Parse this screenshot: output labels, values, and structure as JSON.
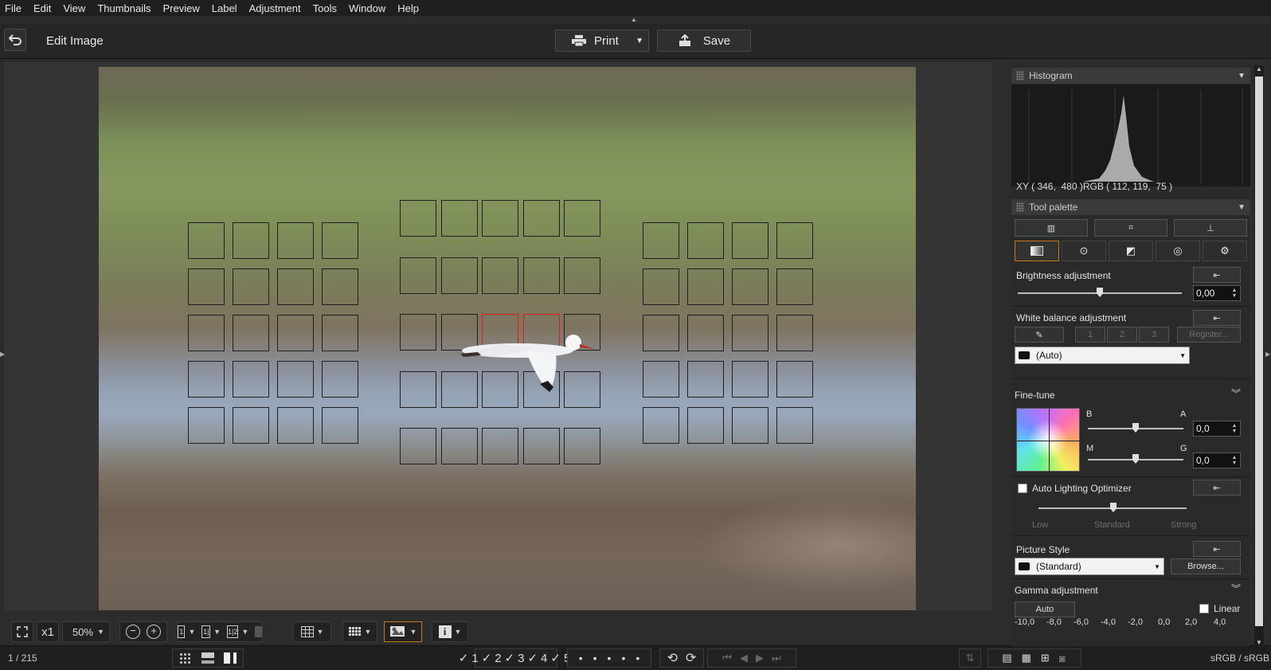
{
  "menu": [
    "File",
    "Edit",
    "View",
    "Thumbnails",
    "Preview",
    "Label",
    "Adjustment",
    "Tools",
    "Window",
    "Help"
  ],
  "header": {
    "title": "Edit Image",
    "print_label": "Print",
    "save_label": "Save"
  },
  "toolbar": {
    "zoom_multiplier": "x1",
    "zoom_value": "50%",
    "rating_labels": [
      "1",
      "2",
      "3",
      "4",
      "5"
    ]
  },
  "status": {
    "counter": "1 / 215",
    "color_space": "sRGB / sRGB"
  },
  "histogram": {
    "title": "Histogram",
    "readout": "XY ( 346,  480 )RGB ( 112, 119,  75 )"
  },
  "tool_palette": {
    "title": "Tool palette",
    "brightness": {
      "label": "Brightness adjustment",
      "value": "0,00",
      "level": 0.5
    },
    "white_balance": {
      "label": "White balance adjustment",
      "presets": [
        "1",
        "2",
        "3"
      ],
      "register": "Register...",
      "mode": "(Auto)"
    },
    "fine_tune": {
      "label": "Fine-tune",
      "b": "B",
      "a": "A",
      "m": "M",
      "g": "G",
      "ba_value": "0,0",
      "mg_value": "0,0"
    },
    "alo": {
      "label": "Auto Lighting Optimizer",
      "low": "Low",
      "standard": "Standard",
      "strong": "Strong"
    },
    "picture_style": {
      "label": "Picture Style",
      "value": "(Standard)",
      "browse": "Browse..."
    },
    "gamma": {
      "label": "Gamma adjustment",
      "auto": "Auto",
      "linear": "Linear",
      "scale": [
        "-10,0",
        "-8,0",
        "-6,0",
        "-4,0",
        "-2,0",
        "0,0",
        "2,0",
        "4,0"
      ]
    }
  }
}
